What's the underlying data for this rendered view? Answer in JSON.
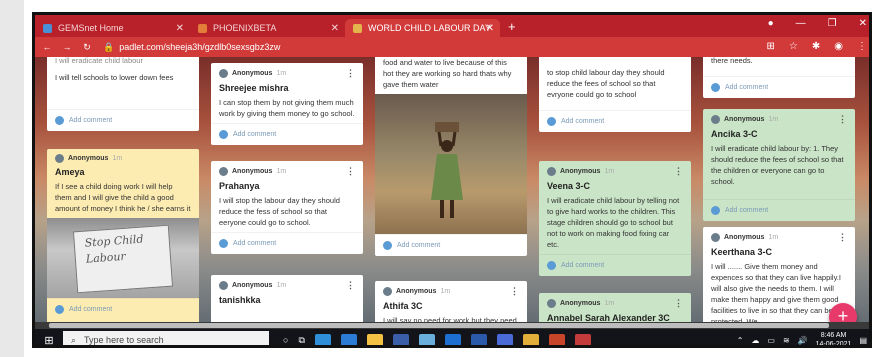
{
  "browser": {
    "tabs": [
      {
        "label": "GEMSnet Home",
        "color": "#4a90d9"
      },
      {
        "label": "PHOENIXBETA",
        "color": "#e27d3a"
      },
      {
        "label": "WORLD CHILD LABOUR DAY",
        "color": "#e4b34c"
      }
    ],
    "new_tab_label": "+",
    "url_label": "padlet.com/sheeja3h/gzdlb0sexsgbz3zw"
  },
  "padlet": {
    "add_comment_label": "Add comment",
    "anonymous_label": "Anonymous",
    "time_label": "1m",
    "fab_label": "+",
    "column1": [
      {
        "title": "",
        "body_top": "I will eradicate child labour",
        "body": "I will tell schools to lower down fees"
      },
      {
        "title": "Ameya",
        "body": "If I see a child doing work I will help them and I will give the child a good amount of money I think he / she earns it",
        "sign_text": "Stop Child Labour"
      }
    ],
    "column2": [
      {
        "title": "Shreejee mishra",
        "body": "I can stop them by not giving them much work by giving them money to go school."
      },
      {
        "title": "Prahanya",
        "body": "I will stop the labour day they should reduce the fess of school so that eeryone could go to school."
      },
      {
        "title": "tanishkka",
        "body": ""
      }
    ],
    "column3": [
      {
        "title": "",
        "body": "food and water to live because of this hot they are working so hard thats why gave them water"
      },
      {
        "title": "Athifa 3C",
        "body": "I will say no need for work but they need to work. So I will give"
      }
    ],
    "column4": [
      {
        "title": "",
        "body": "to stop child labour day they should reduce the fees of school so that evryone could go to school"
      },
      {
        "title": "Veena 3-C",
        "body": "I will eradicate child labour by telling not to give hard works to the children. This stage children should go to school but not to work on making food fixing car etc."
      },
      {
        "title": "Annabel Sarah Alexander 3C",
        "body": ""
      }
    ],
    "column5": [
      {
        "title": "",
        "body": "there needs."
      },
      {
        "title": "Ancika 3-C",
        "body": "I will eradicate child labour by: 1. They should reduce the fees of school so that the children or everyone can go to school."
      },
      {
        "title": "Keerthana 3-C",
        "body": "I will ....... Give them money and expences so that they can live happily.I will also give the needs to them. I will make them happy and give them good facilities to live in so that they can be protected. We"
      }
    ]
  },
  "taskbar": {
    "search_placeholder": "Type here to search",
    "time": "8:46 AM",
    "date": "14-06-2021"
  },
  "colors": {
    "browser_accent": "#d23a3a",
    "card_white": "#ffffff",
    "card_yellow": "#fdecb2",
    "card_green": "#c9e4c6",
    "fab": "#e8396b"
  }
}
